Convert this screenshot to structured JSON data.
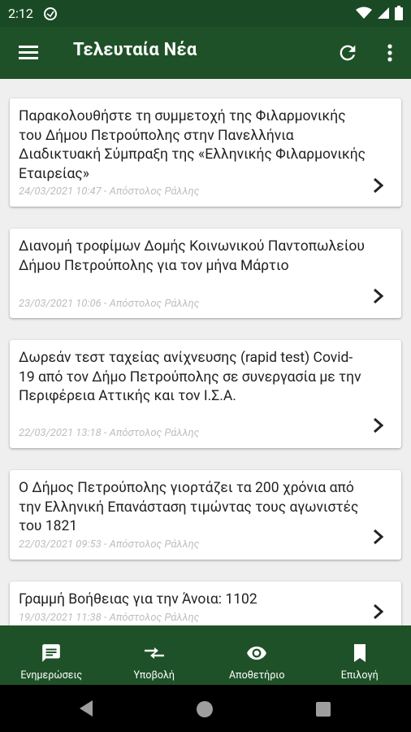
{
  "status_bar": {
    "time": "2:12"
  },
  "app_bar": {
    "title": "Τελευταία Νέα"
  },
  "news": [
    {
      "title": "Παρακολουθήστε τη συμμετοχή της Φιλαρμονικής του Δήμου Πετρούπολης στην Πανελλήνια Διαδικτυακή Σύμπραξη της «Ελληνικής Φιλαρμονικής Εταιρείας»",
      "meta": "24/03/2021 10:47 - Απόστολος Ράλλης"
    },
    {
      "title": "Διανομή τροφίμων Δομής Κοινωνικού Παντοπωλείου Δήμου Πετρούπολης για τον μήνα Μάρτιο",
      "meta": "23/03/2021 10:06 - Απόστολος Ράλλης"
    },
    {
      "title": "Δωρεάν τεστ ταχείας ανίχνευσης (rapid test) Covid-19 από τον Δήμο Πετρούπολης σε συνεργασία με την Περιφέρεια Αττικής και τον Ι.Σ.Α.",
      "meta": "22/03/2021 13:18 - Απόστολος Ράλλης"
    },
    {
      "title": "Ο Δήμος Πετρούπολης γιορτάζει τα 200 χρόνια από την Ελληνική Επανάσταση τιμώντας τους αγωνιστές του 1821",
      "meta": "22/03/2021 09:53 - Απόστολος Ράλλης"
    },
    {
      "title": "Γραμμή Βοήθειας για την Άνοια: 1102",
      "meta": "19/03/2021 11:38 - Απόστολος Ράλλης"
    }
  ],
  "bottom_nav": [
    {
      "label": "Ενημερώσεις",
      "icon": "chat-icon"
    },
    {
      "label": "Υποβολή",
      "icon": "compare-arrows-icon"
    },
    {
      "label": "Αποθετήριο",
      "icon": "eye-icon"
    },
    {
      "label": "Επιλογή",
      "icon": "bookmark-icon"
    }
  ],
  "colors": {
    "status_bar": "#1a4a25",
    "app_bar": "#1f5128",
    "background": "#efefef",
    "meta_text": "#bdbdbd"
  }
}
